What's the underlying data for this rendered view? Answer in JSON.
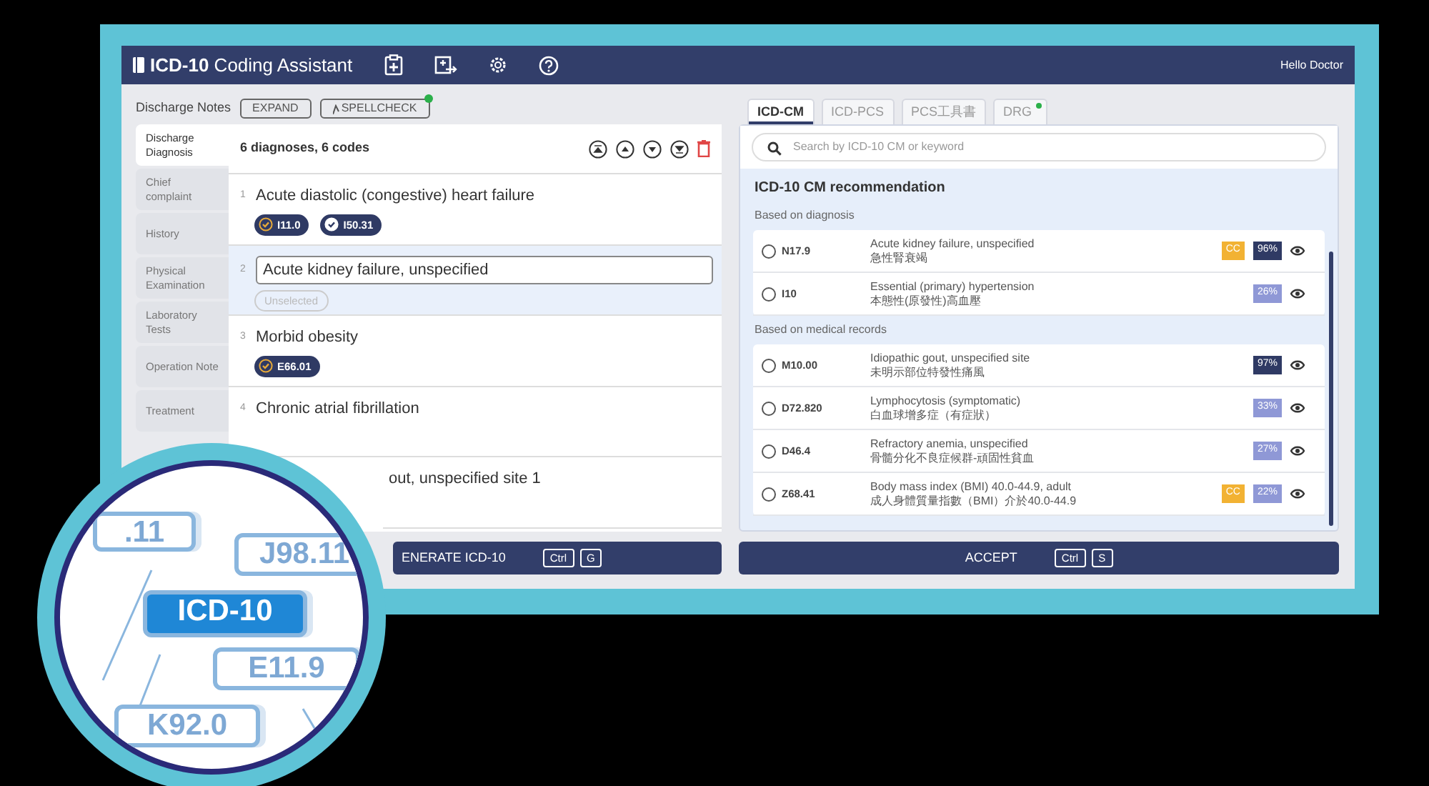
{
  "header": {
    "title_bold": "ICD-10",
    "title_rest": "Coding Assistant",
    "greeting": "Hello Doctor"
  },
  "notes": {
    "label": "Discharge Notes",
    "buttons": [
      {
        "label": "EXPAND",
        "kind": "plain"
      },
      {
        "label": "SPELLCHECK",
        "kind": "spell"
      }
    ]
  },
  "sidebar": {
    "items": [
      {
        "label": "Discharge Diagnosis",
        "selected": true
      },
      {
        "label": "Chief complaint",
        "selected": false
      },
      {
        "label": "History",
        "selected": false
      },
      {
        "label": "Physical Examination",
        "selected": false
      },
      {
        "label": "Laboratory Tests",
        "selected": false
      },
      {
        "label": "Operation Note",
        "selected": false
      },
      {
        "label": "Treatment",
        "selected": false
      }
    ]
  },
  "diagnoses": {
    "summary": "6 diagnoses, 6 codes",
    "rows": [
      {
        "number": "1",
        "text": "Acute diastolic (congestive) heart failure",
        "selected": false,
        "codes": [
          {
            "code": "I11.0",
            "kind": "accent"
          },
          {
            "code": "I50.31",
            "kind": "plain"
          }
        ]
      },
      {
        "number": "2",
        "text": "Acute kidney failure, unspecified",
        "selected": true,
        "codes": [
          {
            "code": "Unselected",
            "kind": "empty"
          }
        ]
      },
      {
        "number": "3",
        "text": "Morbid obesity",
        "selected": false,
        "codes": [
          {
            "code": "E66.01",
            "kind": "accent"
          }
        ]
      },
      {
        "number": "4",
        "text": "Chronic atrial fibrillation",
        "selected": false,
        "codes": []
      },
      {
        "text": "out, unspecified site 1",
        "selected": false,
        "codes": []
      }
    ]
  },
  "generate": {
    "label": "ENERATE ICD-10",
    "keys": [
      "Ctrl",
      "G"
    ]
  },
  "code_tabs": [
    {
      "label": "ICD-CM",
      "selected": true,
      "dot": false
    },
    {
      "label": "ICD-PCS",
      "selected": false,
      "dot": false
    },
    {
      "label": "PCS工具書",
      "selected": false,
      "dot": false
    },
    {
      "label": "DRG",
      "selected": false,
      "dot": true
    }
  ],
  "search": {
    "placeholder": "Search by ICD-10 CM or keyword"
  },
  "recommendation": {
    "title": "ICD-10 CM recommendation",
    "groups": [
      {
        "title": "Based on diagnosis",
        "items": [
          {
            "code": "N17.9",
            "name": "Acute kidney failure, unspecified",
            "name_zh": "急性腎衰竭",
            "tag": "CC",
            "score": "96%",
            "kind": "high",
            "selected": false
          },
          {
            "code": "I10",
            "name": "Essential (primary) hypertension",
            "name_zh": "本態性(原發性)高血壓",
            "score": "26%",
            "kind": "low",
            "selected": false
          }
        ]
      },
      {
        "title": "Based on medical records",
        "items": [
          {
            "code": "M10.00",
            "name": "Idiopathic gout, unspecified site",
            "name_zh": "未明示部位特發性痛風",
            "score": "97%",
            "kind": "high",
            "selected": false
          },
          {
            "code": "D72.820",
            "name": "Lymphocytosis (symptomatic)",
            "name_zh": "白血球增多症（有症狀）",
            "score": "33%",
            "kind": "low",
            "selected": false
          },
          {
            "code": "D46.4",
            "name": "Refractory anemia, unspecified",
            "name_zh": "骨髓分化不良症候群-頑固性貧血",
            "score": "27%",
            "kind": "low",
            "selected": false
          },
          {
            "code": "Z68.41",
            "name": "Body mass index (BMI) 40.0-44.9, adult",
            "name_zh": "成人身體質量指數（BMI）介於40.0-44.9",
            "tag": "CC",
            "score": "22%",
            "kind": "low",
            "selected": false
          }
        ]
      }
    ]
  },
  "accept": {
    "label": "ACCEPT",
    "keys": [
      "Ctrl",
      "S"
    ]
  },
  "magnifier": {
    "tags": [
      {
        "text": ".11",
        "kind": "plain"
      },
      {
        "text": "J98.11",
        "kind": "plain"
      },
      {
        "text": "ICD-10",
        "kind": "primary"
      },
      {
        "text": "E11.9",
        "kind": "plain"
      },
      {
        "text": "K92.0",
        "kind": "plain"
      }
    ]
  }
}
